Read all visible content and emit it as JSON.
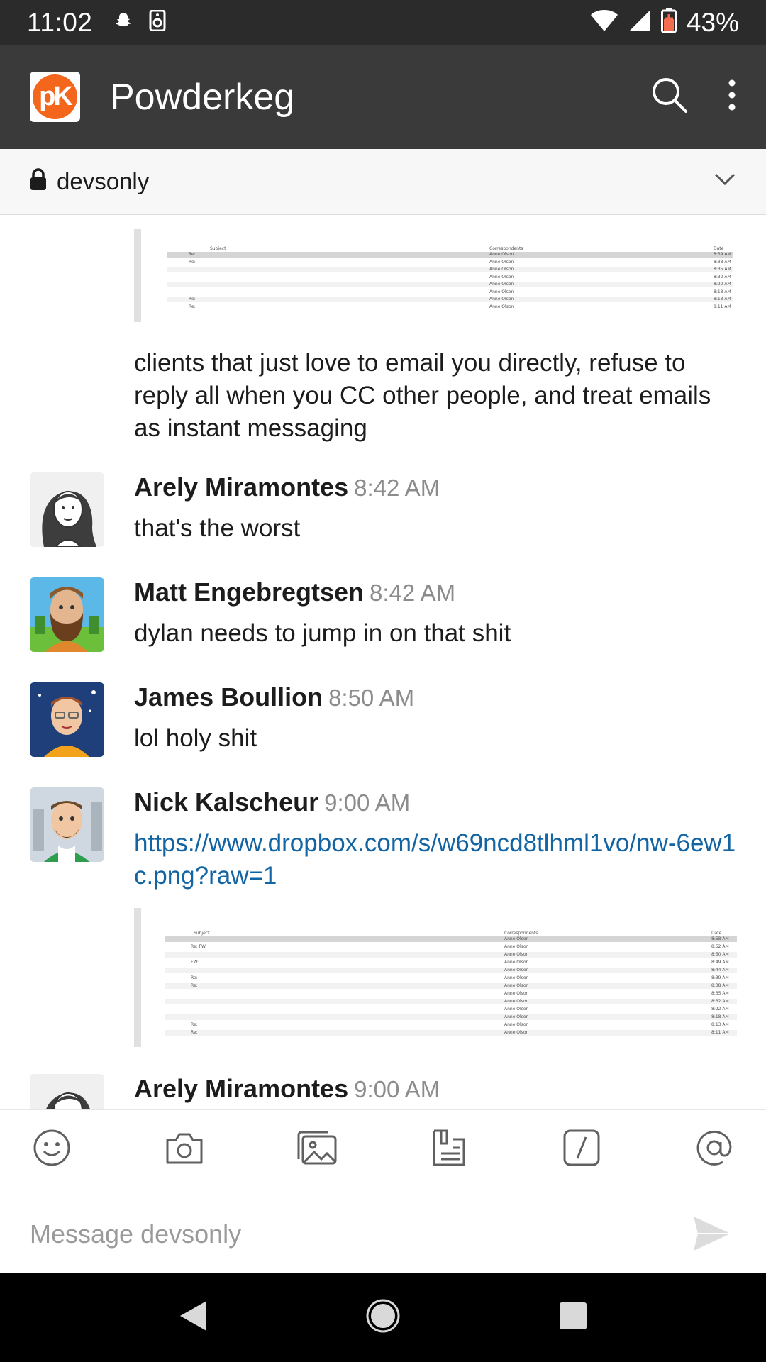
{
  "status_bar": {
    "time": "11:02",
    "battery": "43%"
  },
  "app": {
    "title": "Powderkeg",
    "logo_text": "pK"
  },
  "channel": {
    "name": "devsonly"
  },
  "attachment_rows_1": [
    {
      "subject": "Re:",
      "correspondent": "Anne Olson",
      "date": "8:39 AM"
    },
    {
      "subject": "Re:",
      "correspondent": "Anne Olson",
      "date": "8:38 AM"
    },
    {
      "subject": "",
      "correspondent": "Anne Olson",
      "date": "8:35 AM"
    },
    {
      "subject": "",
      "correspondent": "Anne Olson",
      "date": "8:32 AM"
    },
    {
      "subject": "",
      "correspondent": "Anne Olson",
      "date": "8:22 AM"
    },
    {
      "subject": "",
      "correspondent": "Anne Olson",
      "date": "8:18 AM"
    },
    {
      "subject": "Re:",
      "correspondent": "Anne Olson",
      "date": "8:13 AM"
    },
    {
      "subject": "Re:",
      "correspondent": "Anne Olson",
      "date": "8:11 AM"
    }
  ],
  "attachment_1_headers": {
    "subject": "Subject",
    "correspondents": "Correspondents",
    "date": "Date"
  },
  "continuation_text": "clients that just love to email you directly, refuse to reply all when you CC other people, and treat emails as instant messaging",
  "messages": [
    {
      "author": "Arely Miramontes",
      "time": "8:42 AM",
      "text": "that's the worst"
    },
    {
      "author": "Matt Engebregtsen",
      "time": "8:42 AM",
      "text": "dylan needs to jump in on that shit"
    },
    {
      "author": "James Boullion",
      "time": "8:50 AM",
      "text": "lol holy shit"
    },
    {
      "author": "Nick Kalscheur",
      "time": "9:00 AM",
      "text": "https://www.dropbox.com/s/w69ncd8tlhml1vo/nw-6ew1c.png?raw=1"
    },
    {
      "author": "Arely Miramontes",
      "time": "9:00 AM",
      "text": ""
    }
  ],
  "attachment_2_headers": {
    "subject": "Subject",
    "correspondents": "Correspondents",
    "date": "Date"
  },
  "attachment_rows_2": [
    {
      "subject": "",
      "correspondent": "Anne Olson",
      "date": "8:58 AM"
    },
    {
      "subject": "Re: FW:",
      "correspondent": "Anne Olson",
      "date": "8:52 AM"
    },
    {
      "subject": "",
      "correspondent": "Anne Olson",
      "date": "8:50 AM"
    },
    {
      "subject": "FW:",
      "correspondent": "Anne Olson",
      "date": "8:49 AM"
    },
    {
      "subject": "",
      "correspondent": "Anne Olson",
      "date": "8:44 AM"
    },
    {
      "subject": "Re:",
      "correspondent": "Anne Olson",
      "date": "8:39 AM"
    },
    {
      "subject": "Re:",
      "correspondent": "Anne Olson",
      "date": "8:38 AM"
    },
    {
      "subject": "",
      "correspondent": "Anne Olson",
      "date": "8:35 AM"
    },
    {
      "subject": "",
      "correspondent": "Anne Olson",
      "date": "8:32 AM"
    },
    {
      "subject": "",
      "correspondent": "Anne Olson",
      "date": "8:22 AM"
    },
    {
      "subject": "",
      "correspondent": "Anne Olson",
      "date": "8:18 AM"
    },
    {
      "subject": "Re:",
      "correspondent": "Anne Olson",
      "date": "8:13 AM"
    },
    {
      "subject": "Re:",
      "correspondent": "Anne Olson",
      "date": "8:11 AM"
    }
  ],
  "composer": {
    "placeholder": "Message devsonly"
  },
  "colors": {
    "app_bar": "#3a3a3a",
    "status_bar": "#2b2b2b",
    "link": "#1264a3",
    "logo": "#f4661b"
  }
}
